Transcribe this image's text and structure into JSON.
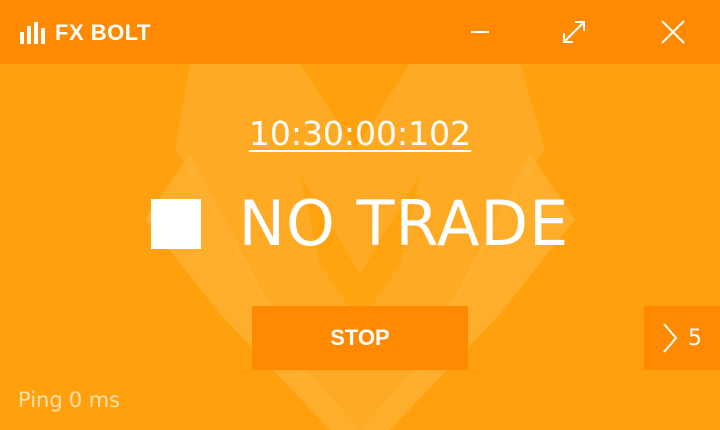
{
  "app": {
    "name": "FX BOLT",
    "icons": {
      "logo": "signal-bars-icon",
      "minimize": "minimize-icon",
      "maximize": "expand-icon",
      "close": "close-icon",
      "status": "stop-square-icon",
      "next": "chevron-right-icon"
    }
  },
  "clock": {
    "time": "10:30:00:102"
  },
  "status": {
    "label": "NO TRADE"
  },
  "controls": {
    "stop_label": "STOP",
    "next_count": "5"
  },
  "footer": {
    "ping_label": "Ping",
    "ping_value": "0 ms"
  },
  "colors": {
    "background": "#ffa00c",
    "bar": "#ff8900",
    "text": "#ffffff",
    "muted_text": "#ffe0a8"
  }
}
